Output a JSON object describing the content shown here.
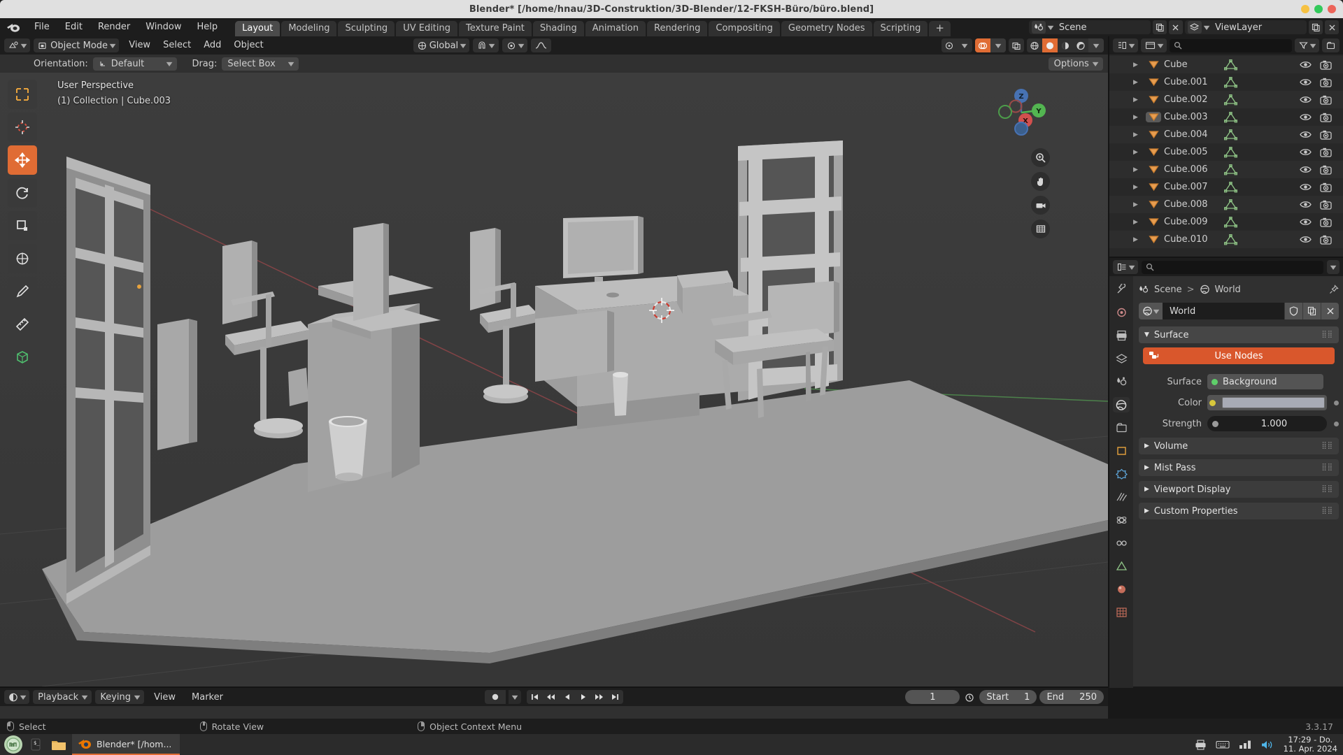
{
  "window": {
    "title": "Blender* [/home/hnau/3D-Construktion/3D-Blender/12-FKSH-Büro/büro.blend]",
    "buttons": [
      "minimize",
      "maximize",
      "close"
    ]
  },
  "topbar": {
    "logo_icon": "blender-logo-icon",
    "menus": [
      "File",
      "Edit",
      "Render",
      "Window",
      "Help"
    ],
    "workspaces": [
      {
        "label": "Layout",
        "active": true
      },
      {
        "label": "Modeling",
        "active": false
      },
      {
        "label": "Sculpting",
        "active": false
      },
      {
        "label": "UV Editing",
        "active": false
      },
      {
        "label": "Texture Paint",
        "active": false
      },
      {
        "label": "Shading",
        "active": false
      },
      {
        "label": "Animation",
        "active": false
      },
      {
        "label": "Rendering",
        "active": false
      },
      {
        "label": "Compositing",
        "active": false
      },
      {
        "label": "Geometry Nodes",
        "active": false
      },
      {
        "label": "Scripting",
        "active": false
      }
    ],
    "add_workspace_label": "+",
    "scene_name": "Scene",
    "viewlayer_name": "ViewLayer"
  },
  "viewport": {
    "header": {
      "editor_type_icon": "editor-type-3dview-icon",
      "mode": "Object Mode",
      "menus": [
        "View",
        "Select",
        "Add",
        "Object"
      ],
      "transform_orientation": "Global",
      "snap_icon": "magnet-icon",
      "proportional_icon": "proportional-edit-icon",
      "falloff_icon": "falloff-curve-icon",
      "shading_modes": [
        "wireframe",
        "solid",
        "material-preview",
        "rendered"
      ],
      "active_shading": "solid"
    },
    "tool_settings": {
      "orientation_label": "Orientation:",
      "orientation_value": "Default",
      "drag_label": "Drag:",
      "drag_value": "Select Box",
      "options_label": "Options"
    },
    "overlay": {
      "view_name": "User Perspective",
      "scene_info": "(1) Collection | Cube.003"
    },
    "toolbar_tools": [
      {
        "name": "select-box-tool",
        "active": false
      },
      {
        "name": "cursor-tool",
        "active": false
      },
      {
        "name": "move-tool",
        "active": true
      },
      {
        "name": "rotate-tool",
        "active": false
      },
      {
        "name": "scale-tool",
        "active": false
      },
      {
        "name": "transform-tool",
        "active": false
      },
      {
        "name": "annotate-tool",
        "active": false
      },
      {
        "name": "measure-tool",
        "active": false
      },
      {
        "name": "add-cube-tool",
        "active": false
      }
    ],
    "gizmo_axes": [
      {
        "label": "Z",
        "color": "#4772b3"
      },
      {
        "label": "Y",
        "color": "#53b551"
      },
      {
        "label": "X",
        "color": "#d3504e"
      }
    ],
    "nav_buttons": [
      "zoom-icon",
      "pan-hand-icon",
      "camera-view-icon",
      "toggle-perspective-icon"
    ]
  },
  "outliner": {
    "display_mode_icon": "outliner-display-mode-icon",
    "filter_icon": "filter-icon",
    "search_placeholder": "",
    "new_collection_icon": "new-collection-icon",
    "columns": {
      "visibility": "eye-icon",
      "render": "camera-icon"
    },
    "items": [
      {
        "name": "Cube",
        "selected": false
      },
      {
        "name": "Cube.001",
        "selected": false
      },
      {
        "name": "Cube.002",
        "selected": false
      },
      {
        "name": "Cube.003",
        "selected": true
      },
      {
        "name": "Cube.004",
        "selected": false
      },
      {
        "name": "Cube.005",
        "selected": false
      },
      {
        "name": "Cube.006",
        "selected": false
      },
      {
        "name": "Cube.007",
        "selected": false
      },
      {
        "name": "Cube.008",
        "selected": false
      },
      {
        "name": "Cube.009",
        "selected": false
      },
      {
        "name": "Cube.010",
        "selected": false
      }
    ]
  },
  "properties": {
    "search_placeholder": "",
    "breadcrumb": [
      "Scene",
      "World"
    ],
    "id_name": "World",
    "id_buttons": [
      "fake-user-shield-icon",
      "duplicate-icon",
      "unlink-x-icon"
    ],
    "tabs": [
      {
        "name": "tool-tab",
        "active": false
      },
      {
        "name": "render-tab",
        "active": false
      },
      {
        "name": "output-tab",
        "active": false
      },
      {
        "name": "view-layer-tab",
        "active": false
      },
      {
        "name": "scene-tab",
        "active": false
      },
      {
        "name": "world-tab",
        "active": true
      },
      {
        "name": "collection-tab",
        "active": false
      },
      {
        "name": "object-tab",
        "active": false
      },
      {
        "name": "modifier-tab",
        "active": false
      },
      {
        "name": "particles-tab",
        "active": false
      },
      {
        "name": "physics-tab",
        "active": false
      },
      {
        "name": "constraints-tab",
        "active": false
      },
      {
        "name": "data-tab",
        "active": false
      },
      {
        "name": "material-tab",
        "active": false
      },
      {
        "name": "texture-tab",
        "active": false
      }
    ],
    "panels": [
      {
        "label": "Surface",
        "open": true
      },
      {
        "label": "Volume",
        "open": false
      },
      {
        "label": "Mist Pass",
        "open": false
      },
      {
        "label": "Viewport Display",
        "open": false
      },
      {
        "label": "Custom Properties",
        "open": false
      }
    ],
    "use_nodes_label": "Use Nodes",
    "surface_label": "Surface",
    "surface_value": "Background",
    "color_label": "Color",
    "color_value": "#a8abb5",
    "strength_label": "Strength",
    "strength_value": "1.000",
    "accent_color": "#d9572c"
  },
  "timeline": {
    "editor_icon": "timeline-editor-icon",
    "playback_label": "Playback",
    "keying_label": "Keying",
    "menus": [
      "View",
      "Marker"
    ],
    "transport": [
      "jump-to-start",
      "jump-prev-keyframe",
      "play-reverse",
      "play",
      "jump-next-keyframe",
      "jump-to-end"
    ],
    "current_frame": "1",
    "start_label": "Start",
    "start_value": "1",
    "end_label": "End",
    "end_value": "250"
  },
  "statusbar": {
    "hints": [
      {
        "mouse": "left",
        "label": "Select"
      },
      {
        "mouse": "middle",
        "label": "Rotate View"
      },
      {
        "mouse": "right",
        "label": "Object Context Menu"
      }
    ],
    "version": "3.3.17"
  },
  "taskbar": {
    "start_icon": "linux-mint-menu-icon",
    "pinned": [
      {
        "name": "terminal-icon"
      },
      {
        "name": "files-folder-icon"
      }
    ],
    "windows": [
      {
        "icon": "blender-logo-icon",
        "label": "Blender* [/hom...",
        "active": true
      }
    ],
    "tray": [
      "printer-icon",
      "keyboard-icon",
      "network-icon",
      "volume-icon"
    ],
    "clock_time": "17:29 - Do.",
    "clock_date": "11. Apr. 2024"
  }
}
